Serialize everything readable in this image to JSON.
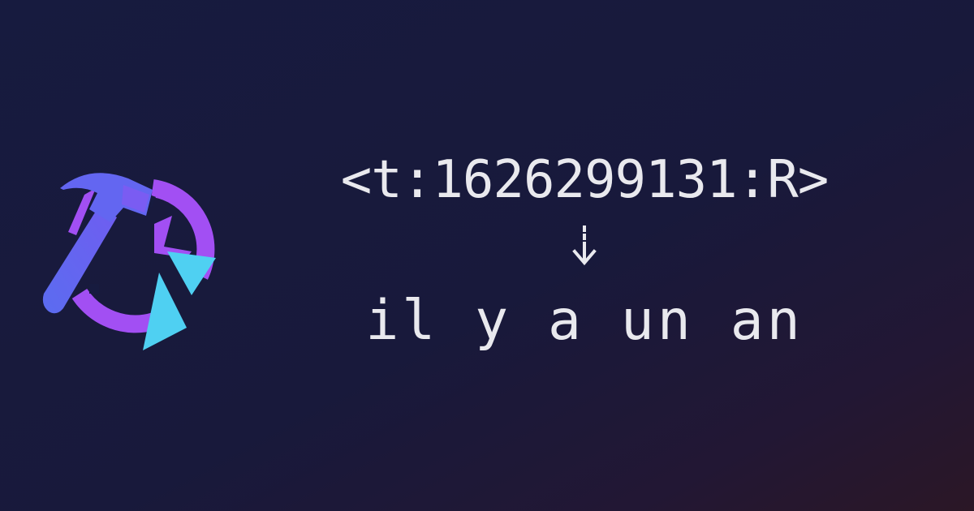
{
  "banner": {
    "logo_icon": "hammer-clock-logo-icon",
    "arrow_icon": "dashed-down-arrow-icon",
    "timestamp_code": "<t:1626299131:R>",
    "rendered_result": "il y a un an"
  },
  "colors": {
    "hammer": "#6366f1",
    "clock_ring": "#a855f7",
    "triangle": "#4fd0f2",
    "text": "#e9e9ee"
  }
}
